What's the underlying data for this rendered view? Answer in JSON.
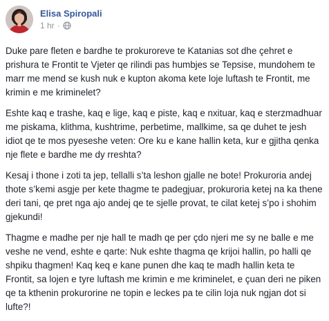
{
  "author": {
    "name": "Elisa Spiropali"
  },
  "meta": {
    "time": "1 hr",
    "separator": "·",
    "privacy_icon": "globe-icon"
  },
  "paragraphs": [
    "Duke pare fleten e bardhe te prokuroreve te Katanias sot dhe çehret e prishura te Frontit te Vjeter qe rilindi pas humbjes se Tepsise, mundohem te marr me mend se kush nuk e kupton akoma kete loje luftash te Frontit, me krimin e me kriminelet?",
    "Eshte kaq e trashe, kaq e lige, kaq e piste, kaq e nxituar, kaq e sterzmadhuar me piskama, klithma, kushtrime, perbetime, mallkime, sa qe duhet te jesh idiot qe te mos pyeseshe veten: Ore ku e kane hallin keta, kur e gjitha qenka nje flete e bardhe me dy rreshta?",
    "Kesaj i thone i zoti ta jep, tellalli s’ta leshon gjalle ne bote! Prokuroria andej thote s’kemi asgje per kete thagme te padegjuar, prokuroria ketej na ka thene deri tani, qe pret nga ajo andej qe te sjelle provat, te cilat ketej s’po i shohim gjekundi!",
    "Thagme e madhe per nje hall te madh qe per çdo njeri me sy ne balle e me veshe ne vend, eshte e qarte: Nuk eshte thagma qe krijoi hallin, po halli qe shpiku thagmen! Kaq keq e kane punen dhe kaq te madh hallin keta te Frontit, sa lojen e tyre luftash me krimin e me kriminelet, e çuan deri ne piken qe ta kthenin prokurorine ne topin e leckes pa te cilin loja nuk ngjan dot si lufte?!"
  ],
  "colors": {
    "author_link": "#365899",
    "meta_text": "#90949c",
    "body_text": "#1d2129"
  }
}
